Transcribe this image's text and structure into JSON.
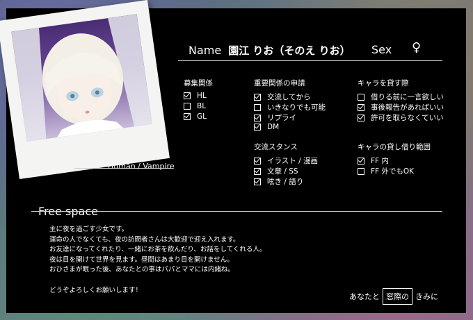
{
  "header": {
    "name_label": "Name",
    "name_value": "園江 りお（そのえ りお）",
    "sex_label": "Sex",
    "sex_value": "♀"
  },
  "species": "Human / Vampire",
  "sections": {
    "recruit": {
      "title": "募集関係",
      "items": [
        {
          "label": "HL",
          "checked": true
        },
        {
          "label": "BL",
          "checked": false
        },
        {
          "label": "GL",
          "checked": true
        }
      ]
    },
    "important": {
      "title": "重要関係の申請",
      "items": [
        {
          "label": "交流してから",
          "checked": true
        },
        {
          "label": "いきなりでも可能",
          "checked": false
        },
        {
          "label": "リプライ",
          "checked": true
        },
        {
          "label": "DM",
          "checked": true
        }
      ]
    },
    "lend": {
      "title": "キャラを貸す際",
      "items": [
        {
          "label": "借りる前に一言欲しい",
          "checked": false
        },
        {
          "label": "事後報告があればいい",
          "checked": true
        },
        {
          "label": "許可を取らなくていい",
          "checked": true
        }
      ]
    },
    "stance": {
      "title": "交流スタンス",
      "items": [
        {
          "label": "イラスト / 漫画",
          "checked": true
        },
        {
          "label": "文章 / SS",
          "checked": true
        },
        {
          "label": "呟き / 語り",
          "checked": true
        }
      ]
    },
    "range": {
      "title": "キャラの貸し借り範囲",
      "items": [
        {
          "label": "FF 内",
          "checked": true
        },
        {
          "label": "FF 外でもOK",
          "checked": false
        }
      ]
    }
  },
  "free_space": {
    "title": "Free space",
    "text": "主に夜を過ごす少女です。\n運命の人でなくても、夜の訪問者さんは大歓迎で迎え入れます。\nお友達になってくれたり、一緒にお茶を飲んだり、お話をしてくれる人。\n夜は目を開けて世界を見ます。昼間はあまり目を開けません。\nおひさまが眠った後、あなたとの事はパパとママには内緒ね。\n\nどうぞよろしくお願いします！"
  },
  "signature": {
    "before": "あなたと",
    "boxed": "窓際の",
    "after": "きみに"
  }
}
